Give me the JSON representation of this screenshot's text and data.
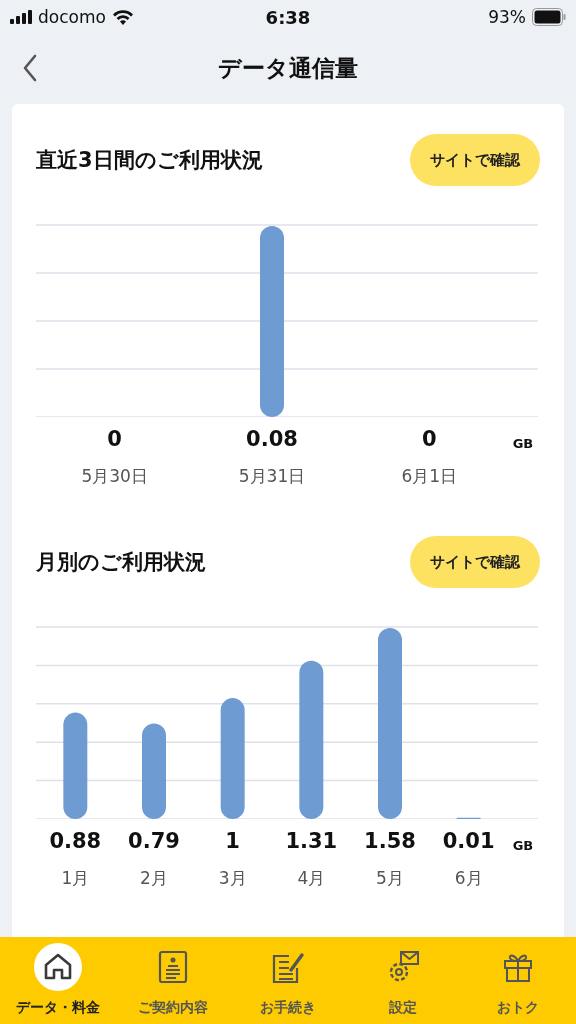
{
  "status_bar": {
    "carrier": "docomo",
    "time": "6:38",
    "battery": "93%"
  },
  "header": {
    "title": "データ通信量"
  },
  "sections": [
    {
      "title": "直近3日間のご利用状況",
      "button": "サイトで確認",
      "unit": "GB",
      "chart_data": {
        "type": "bar",
        "categories": [
          "5月30日",
          "5月31日",
          "6月1日"
        ],
        "values": [
          0,
          0.08,
          0
        ],
        "ylim": [
          0,
          0.08
        ],
        "data_labels": true,
        "value_labels": [
          "0",
          "0.08",
          "0"
        ]
      }
    },
    {
      "title": "月別のご利用状況",
      "button": "サイトで確認",
      "unit": "GB",
      "chart_data": {
        "type": "bar",
        "categories": [
          "1月",
          "2月",
          "3月",
          "4月",
          "5月",
          "6月"
        ],
        "values": [
          0.88,
          0.79,
          1,
          1.31,
          1.58,
          0.01
        ],
        "ylim": [
          0,
          1.58
        ],
        "data_labels": true,
        "value_labels": [
          "0.88",
          "0.79",
          "1",
          "1.31",
          "1.58",
          "0.01"
        ]
      }
    }
  ],
  "tab_bar": [
    {
      "label": "データ・料金",
      "selected": true
    },
    {
      "label": "ご契約内容",
      "selected": false
    },
    {
      "label": "お手続き",
      "selected": false
    },
    {
      "label": "設定",
      "selected": false
    },
    {
      "label": "おトク",
      "selected": false
    }
  ]
}
